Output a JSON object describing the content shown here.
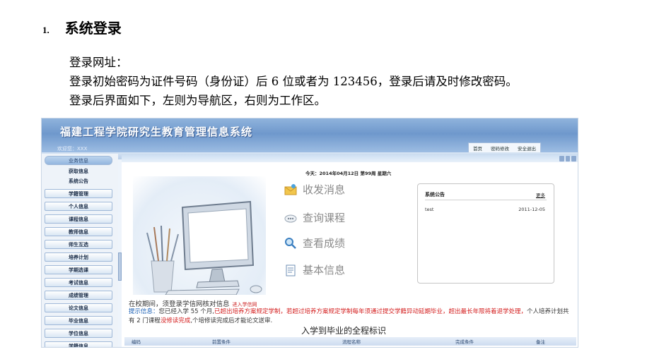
{
  "doc": {
    "section_number": "1.",
    "section_title": "系统登录",
    "line1": "登录网址：",
    "line2": "登录初始密码为证件号码（身份证）后 6 位或者为 123456，登录后请及时修改密码。",
    "line3": "登录后界面如下，左则为导航区，右则为工作区。"
  },
  "screenshot": {
    "system_title": "福建工程学院研究生教育管理信息系统",
    "welcome": "欢迎您：XXX",
    "top_links": [
      "首页",
      "密码修改",
      "安全退出"
    ],
    "nav_header": "业务信息",
    "nav_items": [
      "获取信息",
      "系统公告",
      "学籍管理",
      "个人信息",
      "课程信息",
      "教师信息",
      "师生互选",
      "培养计划",
      "学期选课",
      "考试信息",
      "成绩管理",
      "论文信息",
      "毕业信息",
      "学位信息",
      "学籍信息"
    ],
    "date_text": "今天：2014年04月12日 第99周 星期六",
    "menu": [
      {
        "label": "收发消息",
        "icon": "envelope-icon"
      },
      {
        "label": "查询课程",
        "icon": "search-course-icon"
      },
      {
        "label": "查看成绩",
        "icon": "magnifier-icon"
      },
      {
        "label": "基本信息",
        "icon": "document-icon"
      }
    ],
    "notice": {
      "title": "系统公告",
      "more": "更多",
      "row_title": "test",
      "row_date": "2011-12-05"
    },
    "message1": "在校期间，须登录学信网核对信息",
    "message1_link": "进入学信网",
    "message2_label": "提示信息：",
    "message2_part1": "您已经入学 55 个月,",
    "message2_part2": "已超出培养方案规定学制，若超过培养方案规定学制每年须通过提交学籍异动延期毕业，超出最长年限将着退学处理，",
    "message2_part3": "个人培养计划共有 2 门课程",
    "message2_part4": "没修读完成",
    "message2_part5": ",个培修读完成后才能论文送审.",
    "process_title": "入学到毕业的全程标识",
    "table_headers": [
      "编码",
      "前置条件",
      "流程名称",
      "完成条件",
      "备注"
    ]
  },
  "colors": {
    "banner": "#6f98cc",
    "link_red": "#cc2222",
    "hint_blue": "#1a5fb4"
  }
}
